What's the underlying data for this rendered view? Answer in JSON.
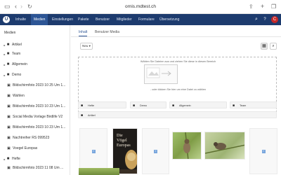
{
  "browser": {
    "url": "ornis.mdtest.ch",
    "icons": [
      "sidebar-toggle-icon",
      "back-icon",
      "forward-icon",
      "reload-icon",
      "share-icon",
      "new-tab-icon",
      "tabs-icon"
    ]
  },
  "cms_nav": {
    "items": [
      "Inhalte",
      "Medien",
      "Einstellungen",
      "Pakete",
      "Benutzer",
      "Mitglieder",
      "Formulare",
      "Übersetzung"
    ],
    "active": "Medien",
    "avatar_letter": "C"
  },
  "sidebar": {
    "title": "Medien",
    "items": [
      {
        "label": "Artikel",
        "type": "folder"
      },
      {
        "label": "Team",
        "type": "folder"
      },
      {
        "label": "Allgemein",
        "type": "folder"
      },
      {
        "label": "Demo",
        "type": "folder"
      },
      {
        "label": "Bildschirmfoto 2023 10 25 Um 1...",
        "type": "file"
      },
      {
        "label": "Wahlen",
        "type": "file"
      },
      {
        "label": "Bildschirmfoto 2023 10 23 Um 1...",
        "type": "file"
      },
      {
        "label": "Social Media Vorlage Birdlife V2",
        "type": "file"
      },
      {
        "label": "Bildschirmfoto 2023 10 23 Um 1...",
        "type": "file"
      },
      {
        "label": "Nachtreiher RS 099523",
        "type": "file"
      },
      {
        "label": "Voegel Europas",
        "type": "file"
      },
      {
        "label": "Hefte",
        "type": "folder"
      },
      {
        "label": "Bildschirmfoto 2023 11 08 Um ...",
        "type": "file"
      }
    ]
  },
  "main": {
    "tabs": [
      {
        "label": "Inhalt",
        "active": true
      },
      {
        "label": "Benutzer Media",
        "active": false
      }
    ],
    "new_button": "Neu ▾",
    "dropzone": {
      "line1": "Wählen Sie Dateien aus und ziehen Sie diese in diesen Bereich",
      "line2": "- oder klicken Sie hier um eine Datei zu wählen"
    },
    "folders": [
      "Hefte",
      "Demo",
      "Allgemein",
      "Team",
      "Artikel"
    ],
    "book_title": "Die Vögel Europas"
  },
  "colors": {
    "nav_bg": "#1d3b6e",
    "nav_active": "#2d5595",
    "avatar": "#c62828",
    "placeholder_icon": "#7aa7dd"
  }
}
